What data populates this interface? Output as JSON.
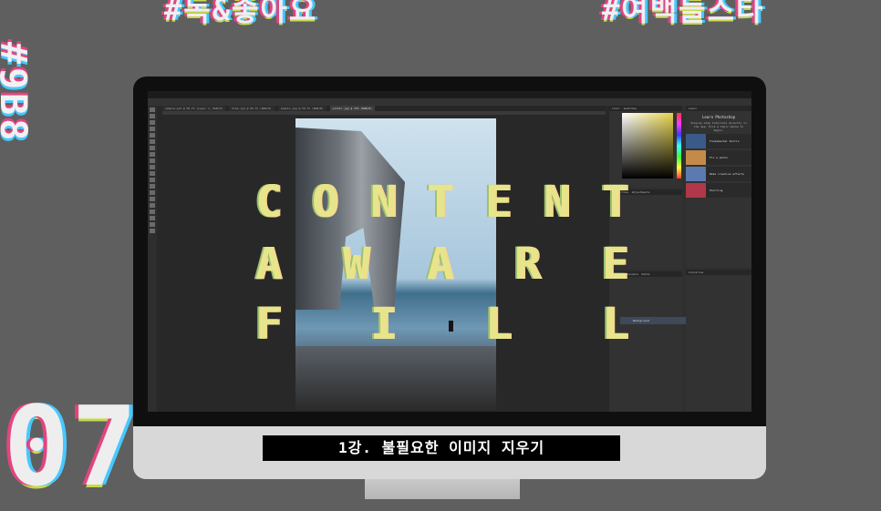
{
  "background": {
    "top_left_text": "#독&좋아요",
    "top_right_text": "#여백들스타",
    "vertical_text": "#9B8",
    "bottom_left_number": "07"
  },
  "photoshop": {
    "tabs": [
      {
        "label": "sample.psd @ 50.7% (Layer 1, RGB/8)"
      },
      {
        "label": "bike.jpg @ 66.7% (RGB/8)"
      },
      {
        "label": "sample.jpg @ 50.7% (RGB/8)"
      },
      {
        "label": "winter.jpg @ 33% (RGB/8)"
      }
    ],
    "panels": {
      "color_tab": "Color",
      "swatches_tab": "Swatches",
      "learn_tab": "Learn",
      "properties_tab": "Properties",
      "adjustments_tab": "Adjustments",
      "layers_tab": "Layers",
      "channels_tab": "Channels",
      "paths_tab": "Paths",
      "libraries_tab": "Libraries"
    },
    "learn": {
      "title": "Learn Photoshop",
      "description": "Step-by-step tutorials directly in the app. Pick a topic below to begin.",
      "items": [
        {
          "label": "Fundamental Skills",
          "color": "#3a5a8a"
        },
        {
          "label": "Fix a photo",
          "color": "#c48a4a"
        },
        {
          "label": "Make creative effects",
          "color": "#5a7ab0"
        },
        {
          "label": "Painting",
          "color": "#b0384a"
        }
      ]
    },
    "layer_name": "Background"
  },
  "overlay": {
    "row1": [
      "C",
      "O",
      "N",
      "T",
      "E",
      "N",
      "T"
    ],
    "row2": [
      "A",
      "W",
      "A",
      "R",
      "E"
    ],
    "row3": [
      "F",
      "I",
      "L",
      "L"
    ]
  },
  "subtitle": "1강. 불필요한 이미지 지우기"
}
